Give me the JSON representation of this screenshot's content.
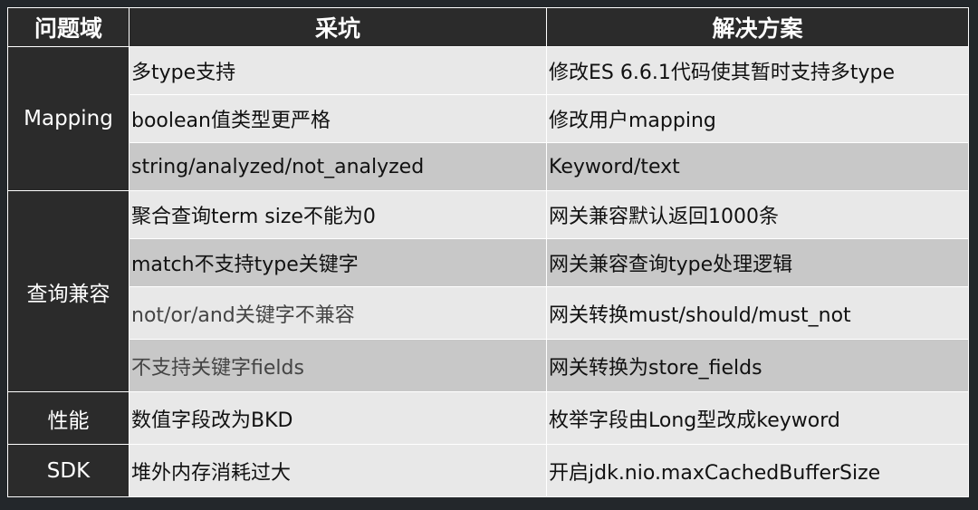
{
  "header": {
    "col_domain": "问题域",
    "col_pitfall": "采坑",
    "col_solution": "解决方案"
  },
  "groups": [
    {
      "domain": "Mapping",
      "rows": [
        {
          "pitfall": "多type支持",
          "solution": "修改ES 6.6.1代码使其暂时支持多type"
        },
        {
          "pitfall": "boolean值类型更严格",
          "solution": "修改用户mapping"
        },
        {
          "pitfall": "string/analyzed/not_analyzed",
          "solution": "Keyword/text"
        }
      ]
    },
    {
      "domain": "查询兼容",
      "rows": [
        {
          "pitfall": "聚合查询term size不能为0",
          "solution": "网关兼容默认返回1000条"
        },
        {
          "pitfall": "match不支持type关键字",
          "solution": "网关兼容查询type处理逻辑"
        },
        {
          "pitfall": "not/or/and关键字不兼容",
          "solution": "网关转换must/should/must_not"
        },
        {
          "pitfall": "不支持关键字fields",
          "solution": "网关转换为store_fields"
        }
      ]
    },
    {
      "domain": "性能",
      "rows": [
        {
          "pitfall": "数值字段改为BKD",
          "solution": "枚举字段由Long型改成keyword"
        }
      ]
    },
    {
      "domain": "SDK",
      "rows": [
        {
          "pitfall": "堆外内存消耗过大",
          "solution": "开启jdk.nio.maxCachedBufferSize"
        }
      ]
    }
  ]
}
